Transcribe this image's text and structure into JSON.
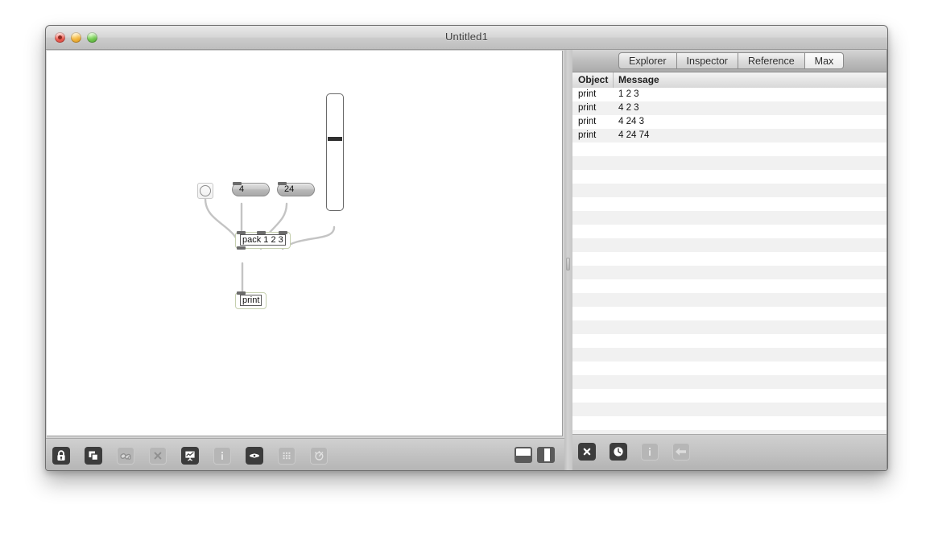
{
  "window": {
    "title": "Untitled1",
    "traffic_lights": [
      "close-button",
      "minimize-button",
      "zoom-button"
    ]
  },
  "patcher": {
    "objects": [
      {
        "type": "bang",
        "name": "bang-object",
        "label": ""
      },
      {
        "type": "number",
        "name": "number-box-4",
        "label": "4"
      },
      {
        "type": "number",
        "name": "number-box-24",
        "label": "24"
      },
      {
        "type": "slider",
        "name": "vertical-slider",
        "label": "",
        "value_fraction": 0.38
      },
      {
        "type": "object",
        "name": "pack-object",
        "label": "pack 1 2 3"
      },
      {
        "type": "object",
        "name": "print-object",
        "label": "print"
      }
    ],
    "toolbar": {
      "items": [
        {
          "name": "lock-icon",
          "state": "on"
        },
        {
          "name": "add-object-icon",
          "state": "on"
        },
        {
          "name": "presentation-mode-icon",
          "state": "off"
        },
        {
          "name": "close-x-icon",
          "state": "off"
        },
        {
          "name": "signal-scope-icon",
          "state": "on"
        },
        {
          "name": "info-icon",
          "state": "off"
        },
        {
          "name": "inspector-oval-icon",
          "state": "on"
        },
        {
          "name": "grid-icon",
          "state": "off"
        },
        {
          "name": "gauge-icon",
          "state": "off"
        }
      ],
      "view_buttons": [
        {
          "name": "horizontal-split-button"
        },
        {
          "name": "vertical-split-button"
        }
      ]
    }
  },
  "console": {
    "tabs": [
      {
        "label": "Explorer",
        "active": false
      },
      {
        "label": "Inspector",
        "active": false
      },
      {
        "label": "Reference",
        "active": false
      },
      {
        "label": "Max",
        "active": true
      }
    ],
    "columns": [
      "Object",
      "Message"
    ],
    "messages": [
      {
        "object": "print",
        "message": "1 2 3"
      },
      {
        "object": "print",
        "message": "4 2 3"
      },
      {
        "object": "print",
        "message": "4 24 3"
      },
      {
        "object": "print",
        "message": "4 24 74"
      }
    ],
    "total_rows": 28,
    "toolbar": [
      {
        "name": "clear-console-icon",
        "state": "on"
      },
      {
        "name": "clock-icon",
        "state": "on"
      },
      {
        "name": "info-icon",
        "state": "off"
      },
      {
        "name": "back-arrow-icon",
        "state": "off"
      }
    ]
  },
  "colors": {
    "object_border": "#c5cfae",
    "cord": "#c6c6c6",
    "titlebar": "#d6d6d6",
    "row_stripe": "#f1f1f1"
  }
}
